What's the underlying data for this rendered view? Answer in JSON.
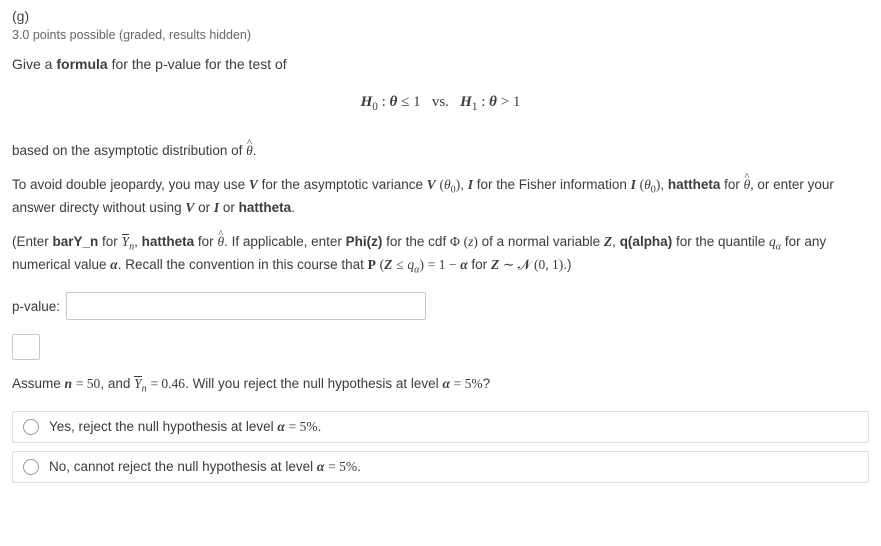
{
  "part_label": "(g)",
  "points": "3.0 points possible (graded, results hidden)",
  "prompt_lead": "Give a ",
  "prompt_bold": "formula",
  "prompt_tail": " for the p-value for the test of",
  "hypotheses": "H₀ : θ ≤ 1   vs.   H₁ : θ > 1",
  "para1_a": "based on the asymptotic distribution of ",
  "para1_b": ".",
  "para2_a": "To avoid double jeopardy, you may use ",
  "para2_b": " for the asymptotic variance ",
  "para2_b2": ", ",
  "para2_c": " for the Fisher information ",
  "para2_c2": ", ",
  "para2_d": "hattheta",
  "para2_e": " for ",
  "para2_f": "  or enter your answer directy without using ",
  "para2_g": " or ",
  "para2_h": " or ",
  "para2_i": "hattheta",
  "para2_j": ".",
  "para3_a": "(Enter ",
  "para3_b": "barY_n",
  "para3_c": " for ",
  "para3_d": ",  ",
  "para3_e": "hattheta",
  "para3_f": " for ",
  "para3_g": ".  If applicable, enter ",
  "para3_h": "Phi(z)",
  "para3_i": " for the cdf ",
  "para3_j": " of a normal variable ",
  "para3_k": ", ",
  "para3_l": "q(alpha)",
  "para3_m": " for the quantile ",
  "para3_n": " for any numerical value ",
  "para3_o": ".   Recall the convention in this course that ",
  "para3_p": " for ",
  "para3_q": ".)",
  "label_pvalue": "p-value:",
  "input_value": "",
  "para4_a": "Assume ",
  "para4_b": ", and ",
  "para4_c": ". Will you reject the null hypothesis at level ",
  "para4_d": "?",
  "opt1_a": "Yes, reject the null hypothesis at level ",
  "opt1_b": ".",
  "opt2_a": "No, cannot reject the null hypothesis at level ",
  "opt2_b": "."
}
